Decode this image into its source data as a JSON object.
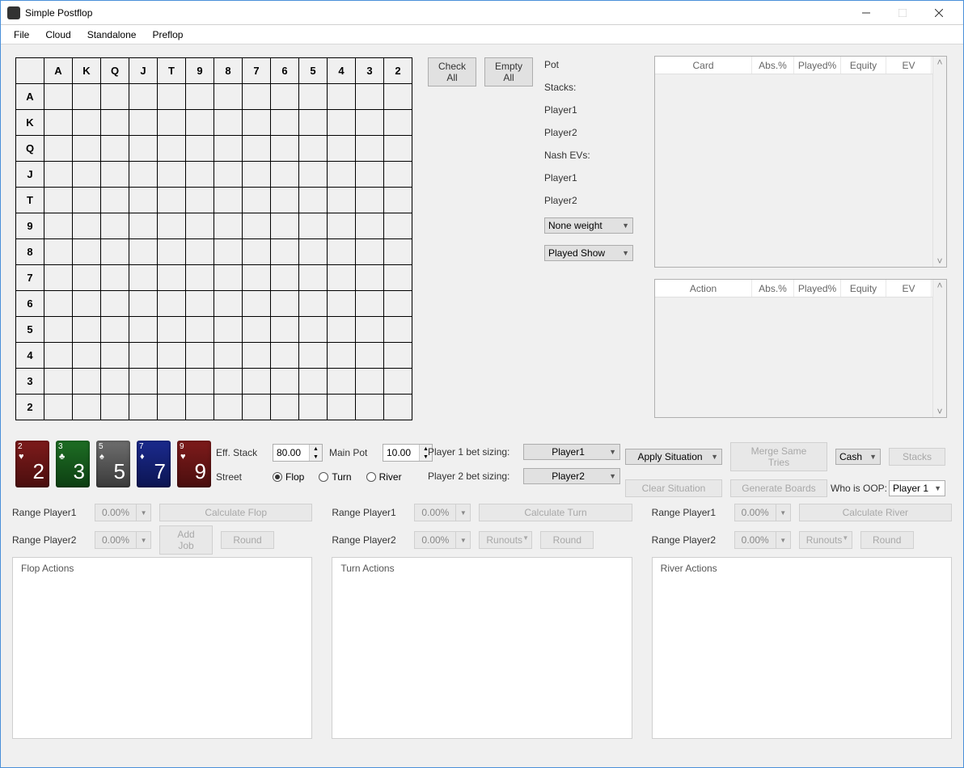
{
  "window": {
    "title": "Simple Postflop"
  },
  "menubar": [
    "File",
    "Cloud",
    "Standalone",
    "Preflop"
  ],
  "ranks": [
    "A",
    "K",
    "Q",
    "J",
    "T",
    "9",
    "8",
    "7",
    "6",
    "5",
    "4",
    "3",
    "2"
  ],
  "buttons": {
    "check_all": "Check All",
    "empty_all": "Empty All",
    "apply_situation": "Apply Situation",
    "clear_situation": "Clear Situation",
    "merge_tries": "Merge Same Tries",
    "generate_boards": "Generate Boards",
    "stacks": "Stacks",
    "calc_flop": "Calculate Flop",
    "calc_turn": "Calculate Turn",
    "calc_river": "Calculate River",
    "add_job": "Add Job",
    "round": "Round",
    "runouts": "Runouts"
  },
  "info_labels": {
    "pot": "Pot",
    "stacks": "Stacks:",
    "player1": "Player1",
    "player2": "Player2",
    "nash": "Nash EVs:"
  },
  "selects": {
    "weight": "None weight",
    "played_show": "Played Show",
    "p1_sizing": "Player1",
    "p2_sizing": "Player2",
    "game_type": "Cash",
    "who_oop": "Player 1"
  },
  "list_headers": {
    "card": {
      "c0": "Card",
      "c1": "Abs.%",
      "c2": "Played%",
      "c3": "Equity",
      "c4": "EV"
    },
    "action": {
      "c0": "Action",
      "c1": "Abs.%",
      "c2": "Played%",
      "c3": "Equity",
      "c4": "EV"
    }
  },
  "cards": [
    {
      "rank": "2",
      "suit": "♥",
      "cls": "red"
    },
    {
      "rank": "3",
      "suit": "♣",
      "cls": "green"
    },
    {
      "rank": "5",
      "suit": "♠",
      "cls": "grey"
    },
    {
      "rank": "7",
      "suit": "♦",
      "cls": "blue"
    },
    {
      "rank": "9",
      "suit": "♥",
      "cls": "red"
    }
  ],
  "settings": {
    "eff_stack_label": "Eff. Stack",
    "eff_stack_value": "80.00",
    "main_pot_label": "Main Pot",
    "main_pot_value": "10.00",
    "street_label": "Street",
    "street_options": {
      "flop": "Flop",
      "turn": "Turn",
      "river": "River"
    },
    "p1_sizing_label": "Player 1 bet sizing:",
    "p2_sizing_label": "Player 2 bet sizing:",
    "who_oop_label": "Who is OOP:"
  },
  "range": {
    "p1_label": "Range Player1",
    "p2_label": "Range Player2",
    "pct": "0.00%"
  },
  "actions_panels": {
    "flop": "Flop Actions",
    "turn": "Turn Actions",
    "river": "River Actions"
  }
}
